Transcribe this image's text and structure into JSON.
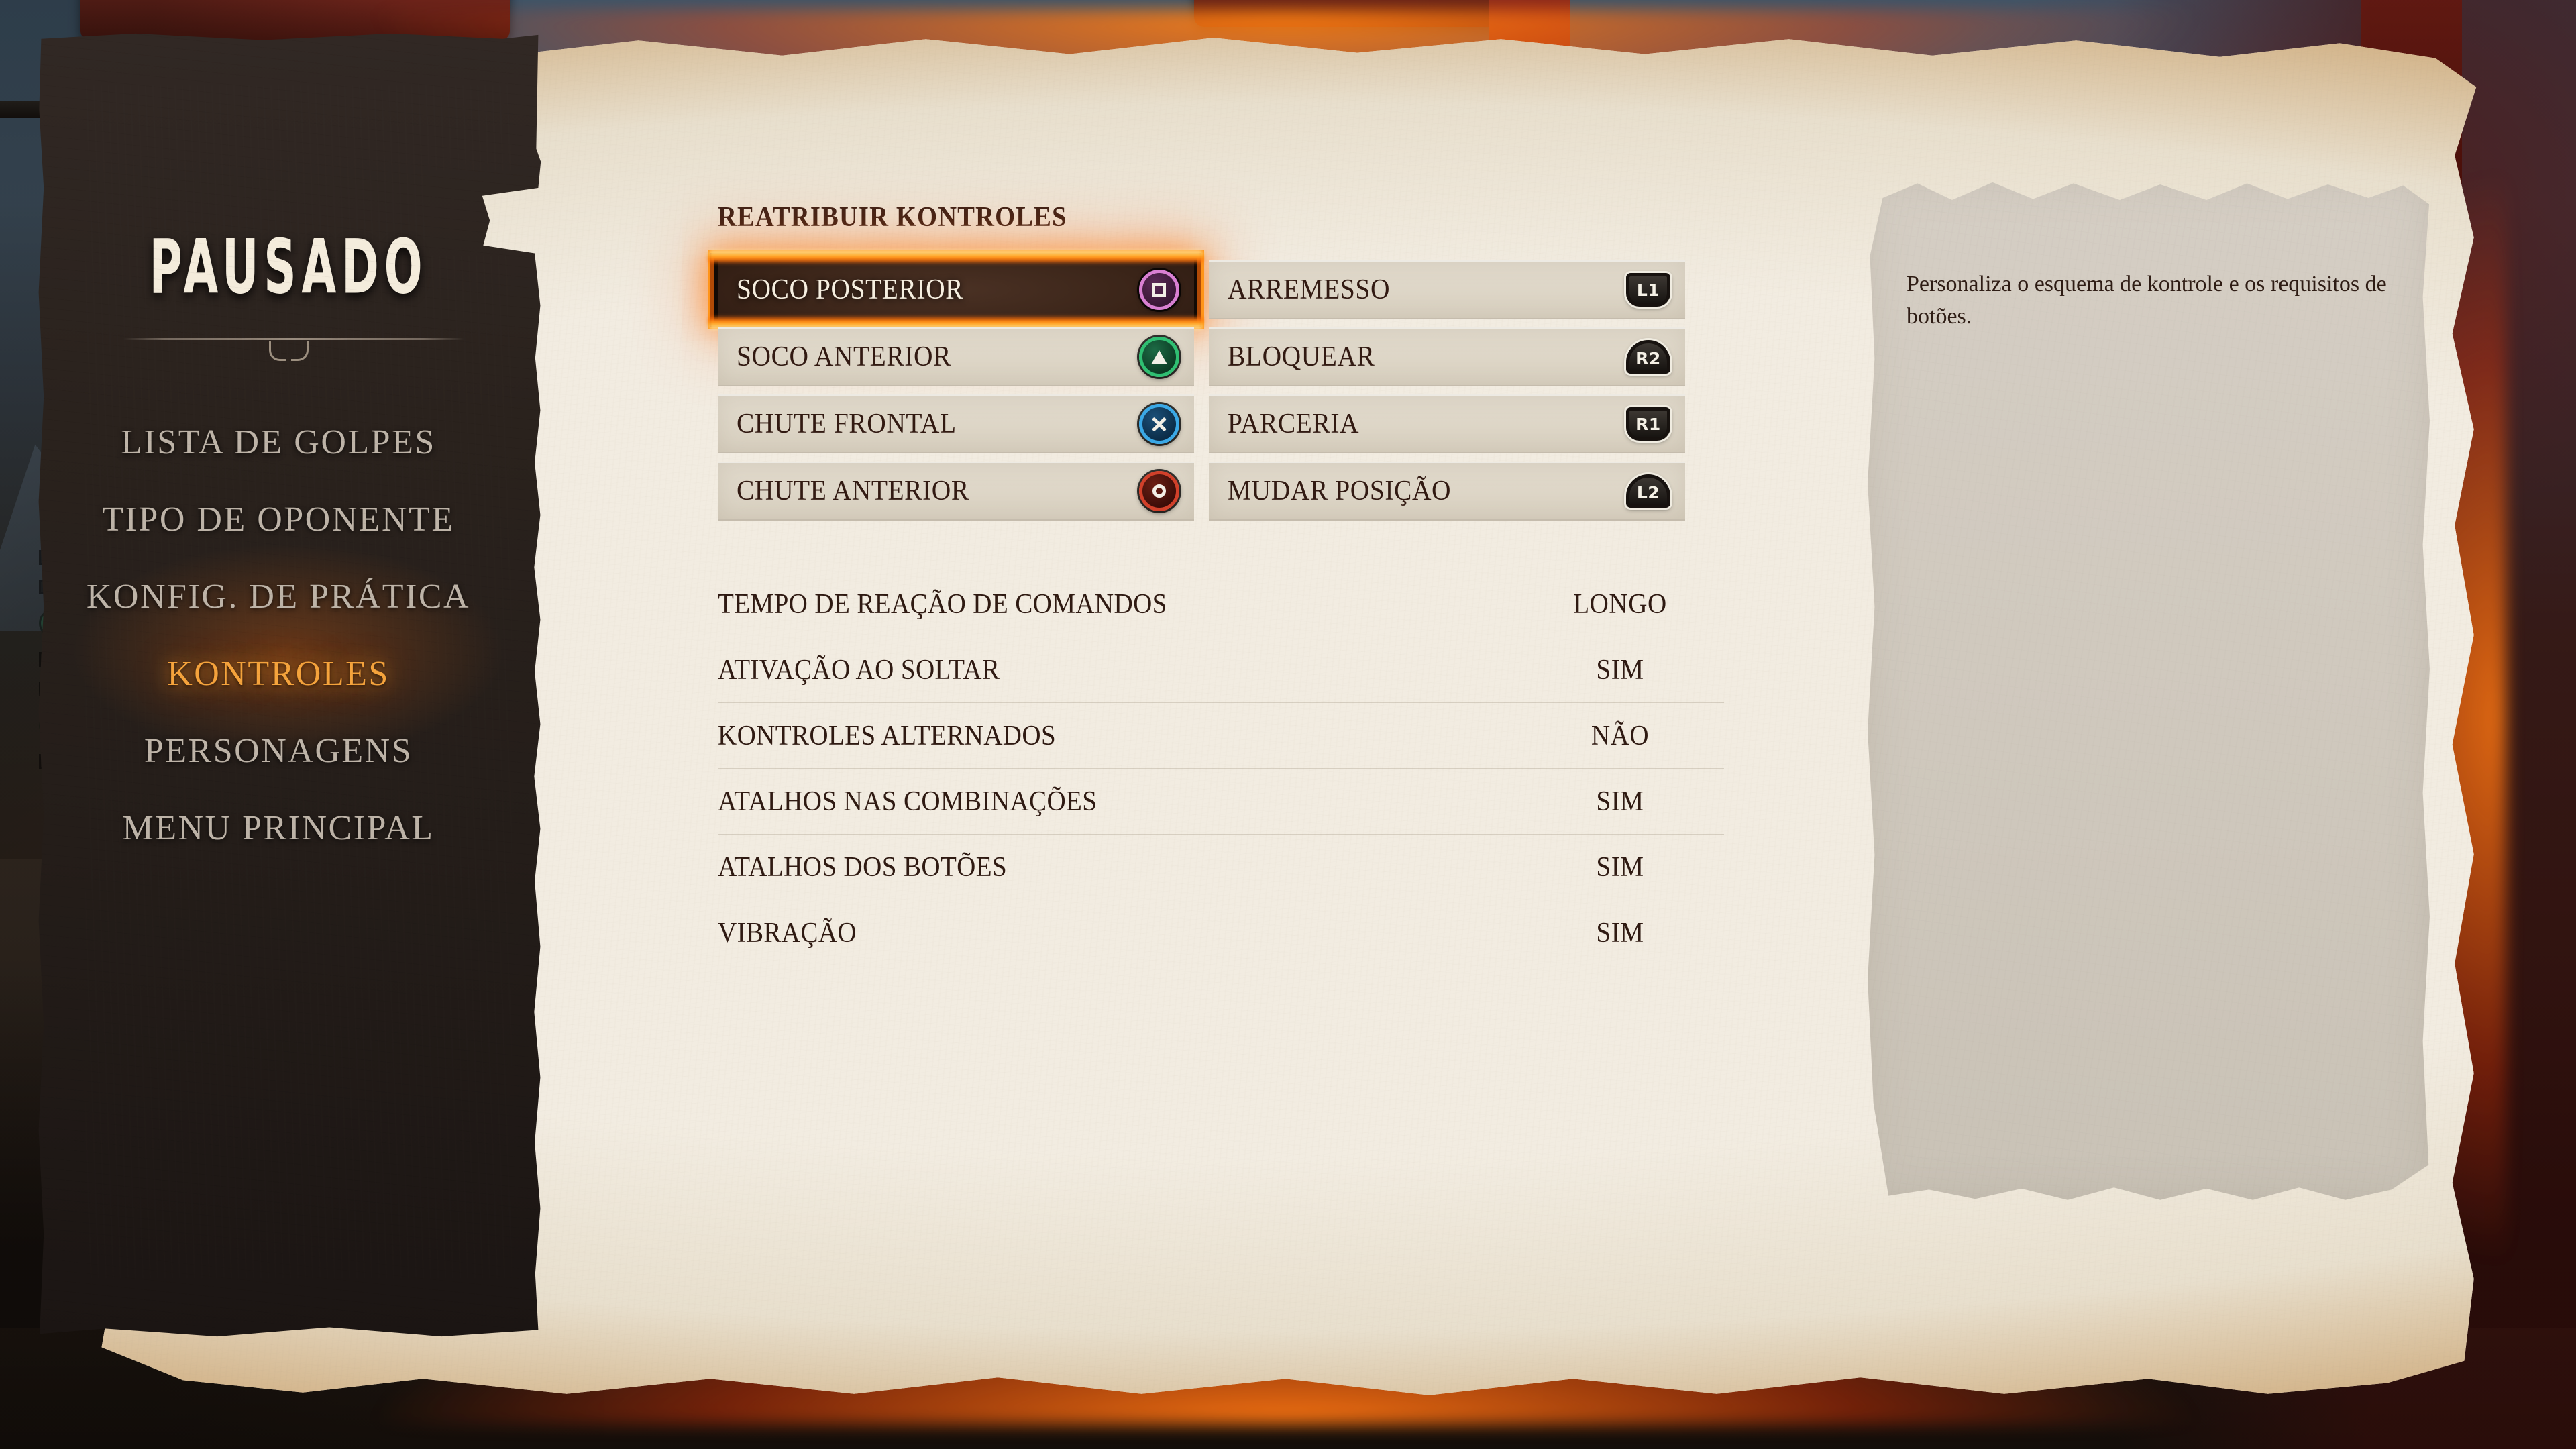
{
  "sidebar": {
    "title": "PAUSADO",
    "items": [
      {
        "label": "LISTA DE GOLPES",
        "active": false
      },
      {
        "label": "TIPO DE OPONENTE",
        "active": false
      },
      {
        "label": "KONFIG. DE PRÁTICA",
        "active": false
      },
      {
        "label": "KONTROLES",
        "active": true
      },
      {
        "label": "PERSONAGENS",
        "active": false
      },
      {
        "label": "MENU PRINCIPAL",
        "active": false
      }
    ],
    "active_color": "#f5a33c",
    "inactive_color": "#bdb3a7"
  },
  "content": {
    "section_title": "REATRIBUIR KONTROLES",
    "bindings": [
      {
        "label": "SOCO POSTERIOR",
        "button": "square",
        "button_label": "□",
        "selected": true,
        "color": "#d87fd2"
      },
      {
        "label": "ARREMESSO",
        "button": "L1",
        "button_label": "L1",
        "selected": false,
        "color": "#17120f"
      },
      {
        "label": "SOCO ANTERIOR",
        "button": "triangle",
        "button_label": "△",
        "selected": false,
        "color": "#2fbf72"
      },
      {
        "label": "BLOQUEAR",
        "button": "R2",
        "button_label": "R2",
        "selected": false,
        "color": "#17120f"
      },
      {
        "label": "CHUTE FRONTAL",
        "button": "cross",
        "button_label": "✕",
        "selected": false,
        "color": "#3aa8e6"
      },
      {
        "label": "PARCERIA",
        "button": "R1",
        "button_label": "R1",
        "selected": false,
        "color": "#17120f"
      },
      {
        "label": "CHUTE ANTERIOR",
        "button": "circle",
        "button_label": "○",
        "selected": false,
        "color": "#d1402a"
      },
      {
        "label": "MUDAR POSIÇÃO",
        "button": "L2",
        "button_label": "L2",
        "selected": false,
        "color": "#17120f"
      }
    ],
    "settings": [
      {
        "name": "TEMPO DE REAÇÃO DE COMANDOS",
        "value": "LONGO"
      },
      {
        "name": "ATIVAÇÃO AO SOLTAR",
        "value": "SIM"
      },
      {
        "name": "KONTROLES ALTERNADOS",
        "value": "NÃO"
      },
      {
        "name": "ATALHOS NAS COMBINAÇÕES",
        "value": "SIM"
      },
      {
        "name": "ATALHOS DOS BOTÕES",
        "value": "SIM"
      },
      {
        "name": "VIBRAÇÃO",
        "value": "SIM"
      }
    ]
  },
  "description": {
    "text": "Personaliza o esquema de kontrole e os requisitos de botões."
  },
  "theme": {
    "parchment": "#efe8dc",
    "panel": "#cfc8bd",
    "ink": "#2f1a12",
    "ember": "#ff9418",
    "sidebar_bg": "#241d19"
  }
}
